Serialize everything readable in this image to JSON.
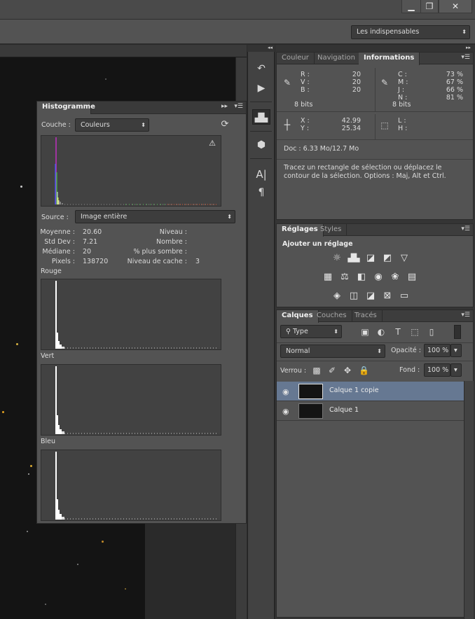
{
  "window": {
    "minimize_icon": "minimize-icon",
    "maximize_icon": "restore-icon",
    "close_icon": "close-icon"
  },
  "workspace_switcher": {
    "value": "Les indispensables"
  },
  "info_panel": {
    "tabs": [
      "Couleur",
      "Navigation",
      "Informations"
    ],
    "active_tab": "Informations",
    "rgb": {
      "labels": [
        "R :",
        "V :",
        "B :"
      ],
      "values": [
        "20",
        "20",
        "20"
      ],
      "bits": "8 bits"
    },
    "cmyk": {
      "labels": [
        "C :",
        "M :",
        "J :",
        "N :"
      ],
      "values": [
        "73 %",
        "67 %",
        "66 %",
        "81 %"
      ],
      "bits": "8 bits"
    },
    "coords": {
      "labels": [
        "X :",
        "Y :"
      ],
      "values": [
        "42.99",
        "25.34"
      ]
    },
    "size": {
      "labels": [
        "L :",
        "H :"
      ]
    },
    "doc": "Doc : 6.33 Mo/12.7 Mo",
    "hint": "Tracez un rectangle de sélection ou déplacez le contour de la sélection. Options : Maj, Alt et Ctrl."
  },
  "adjust_panel": {
    "tabs": [
      "Réglages",
      "Styles"
    ],
    "active_tab": "Réglages",
    "heading": "Ajouter un réglage"
  },
  "layers_panel": {
    "tabs": [
      "Calques",
      "Couches",
      "Tracés"
    ],
    "active_tab": "Calques",
    "filter": "Type",
    "blend_mode": "Normal",
    "opacity_label": "Opacité :",
    "opacity_value": "100 %",
    "lock_label": "Verrou :",
    "fill_label": "Fond :",
    "fill_value": "100 %",
    "layers": [
      {
        "name": "Calque 1 copie",
        "selected": true
      },
      {
        "name": "Calque 1",
        "selected": false
      }
    ]
  },
  "histogram": {
    "title": "Histogramme",
    "channel_label": "Couche :",
    "channel_value": "Couleurs",
    "source_label": "Source :",
    "source_value": "Image entière",
    "stats_left": {
      "labels": [
        "Moyenne :",
        "Std Dev :",
        "Médiane :",
        "Pixels :"
      ],
      "values": [
        "20.60",
        "7.21",
        "20",
        "138720"
      ]
    },
    "stats_right": {
      "labels": [
        "Niveau :",
        "Nombre :",
        "% plus sombre :",
        "Niveau de cache :"
      ],
      "values": [
        "",
        "",
        "",
        "3"
      ]
    },
    "channels": [
      "Rouge",
      "Vert",
      "Bleu"
    ],
    "warning_icon": "warning-icon",
    "refresh_icon": "refresh-icon"
  }
}
